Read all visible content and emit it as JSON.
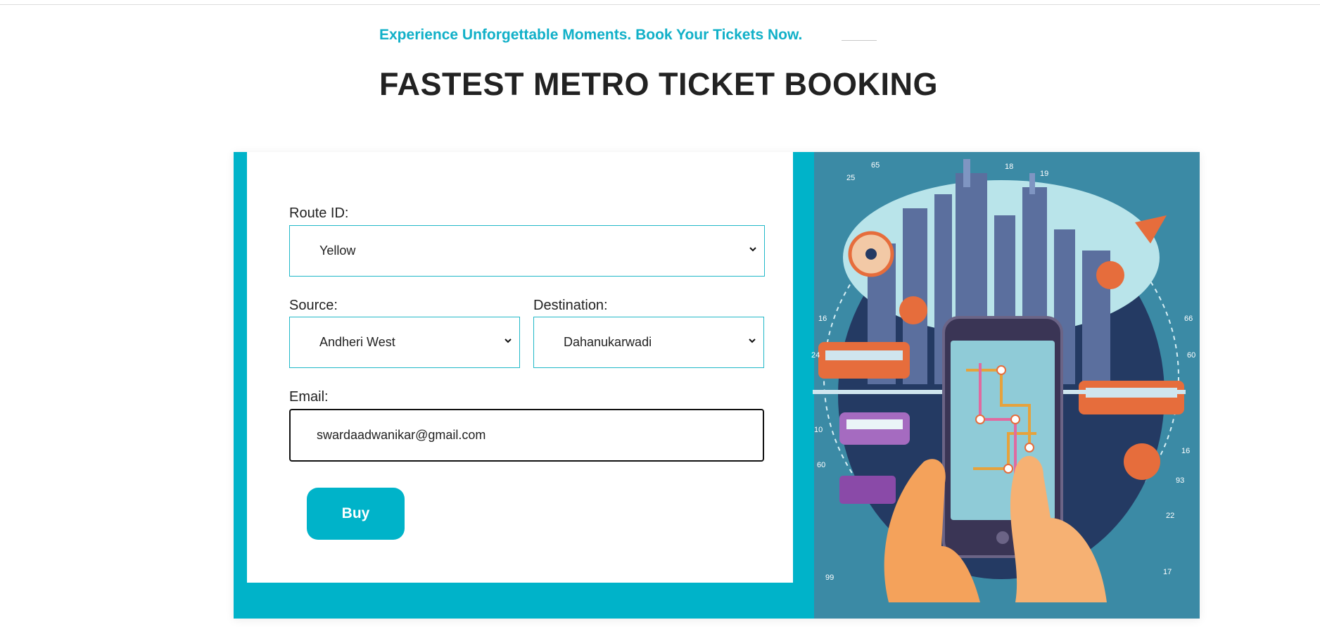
{
  "header": {
    "tagline": "Experience Unforgettable Moments. Book Your Tickets Now.",
    "title": "FASTEST METRO TICKET BOOKING"
  },
  "form": {
    "route_label": "Route ID:",
    "route_value": "Yellow",
    "source_label": "Source:",
    "source_value": "Andheri West",
    "destination_label": "Destination:",
    "destination_value": "Dahanukarwadi",
    "email_label": "Email:",
    "email_value": "swardaadwanikar@gmail.com",
    "buy_label": "Buy"
  },
  "colors": {
    "accent": "#00b3c9",
    "illustration_bg": "#3b8aa5"
  },
  "icons": [
    "chevron-down-icon"
  ]
}
